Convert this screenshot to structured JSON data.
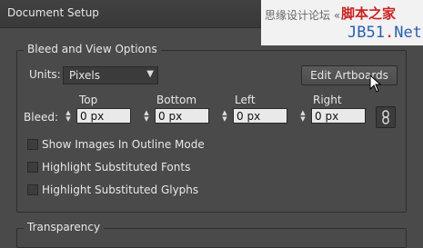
{
  "dialog": {
    "title": "Document Setup"
  },
  "watermark": {
    "site_text": "思缘设计论坛 «",
    "brand": "脚本之家",
    "domain_a": "JB51",
    "domain_b": ".",
    "domain_c": "Net"
  },
  "bleed_view": {
    "title": "Bleed and View Options",
    "units_label": "Units:",
    "units_value": "Pixels",
    "edit_artboards": "Edit Artboards",
    "bleed_label": "Bleed:",
    "columns": [
      "Top",
      "Bottom",
      "Left",
      "Right"
    ],
    "values": [
      "0 px",
      "0 px",
      "0 px",
      "0 px"
    ],
    "options": [
      {
        "label": "Show Images In Outline Mode",
        "checked": false
      },
      {
        "label": "Highlight Substituted Fonts",
        "checked": false
      },
      {
        "label": "Highlight Substituted Glyphs",
        "checked": false
      }
    ]
  },
  "transparency": {
    "title": "Transparency"
  },
  "icons": {
    "dropdown": "chevron-down-icon",
    "link": "chain-link-icon",
    "spin": "spinner-arrows-icon",
    "cursor": "mouse-pointer-icon"
  }
}
